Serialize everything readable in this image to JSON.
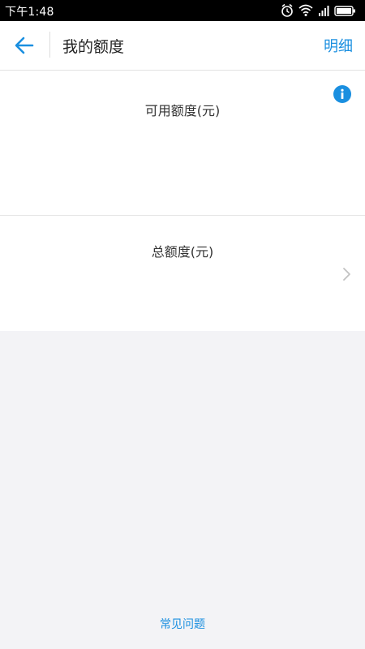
{
  "status_bar": {
    "time": "下午1:48",
    "icons": [
      "alarm-icon",
      "wifi-icon",
      "signal-icon",
      "battery-icon"
    ]
  },
  "nav": {
    "back_icon": "back-arrow-icon",
    "title": "我的额度",
    "detail_link": "明细"
  },
  "available": {
    "label": "可用额度(元)",
    "info_icon": "info-icon"
  },
  "total": {
    "label": "总额度(元)",
    "chevron_icon": "chevron-right-icon"
  },
  "footer": {
    "faq": "常见问题"
  },
  "colors": {
    "accent": "#1a8fe0",
    "background": "#f3f3f6",
    "card": "#ffffff",
    "status_bar": "#000000"
  }
}
